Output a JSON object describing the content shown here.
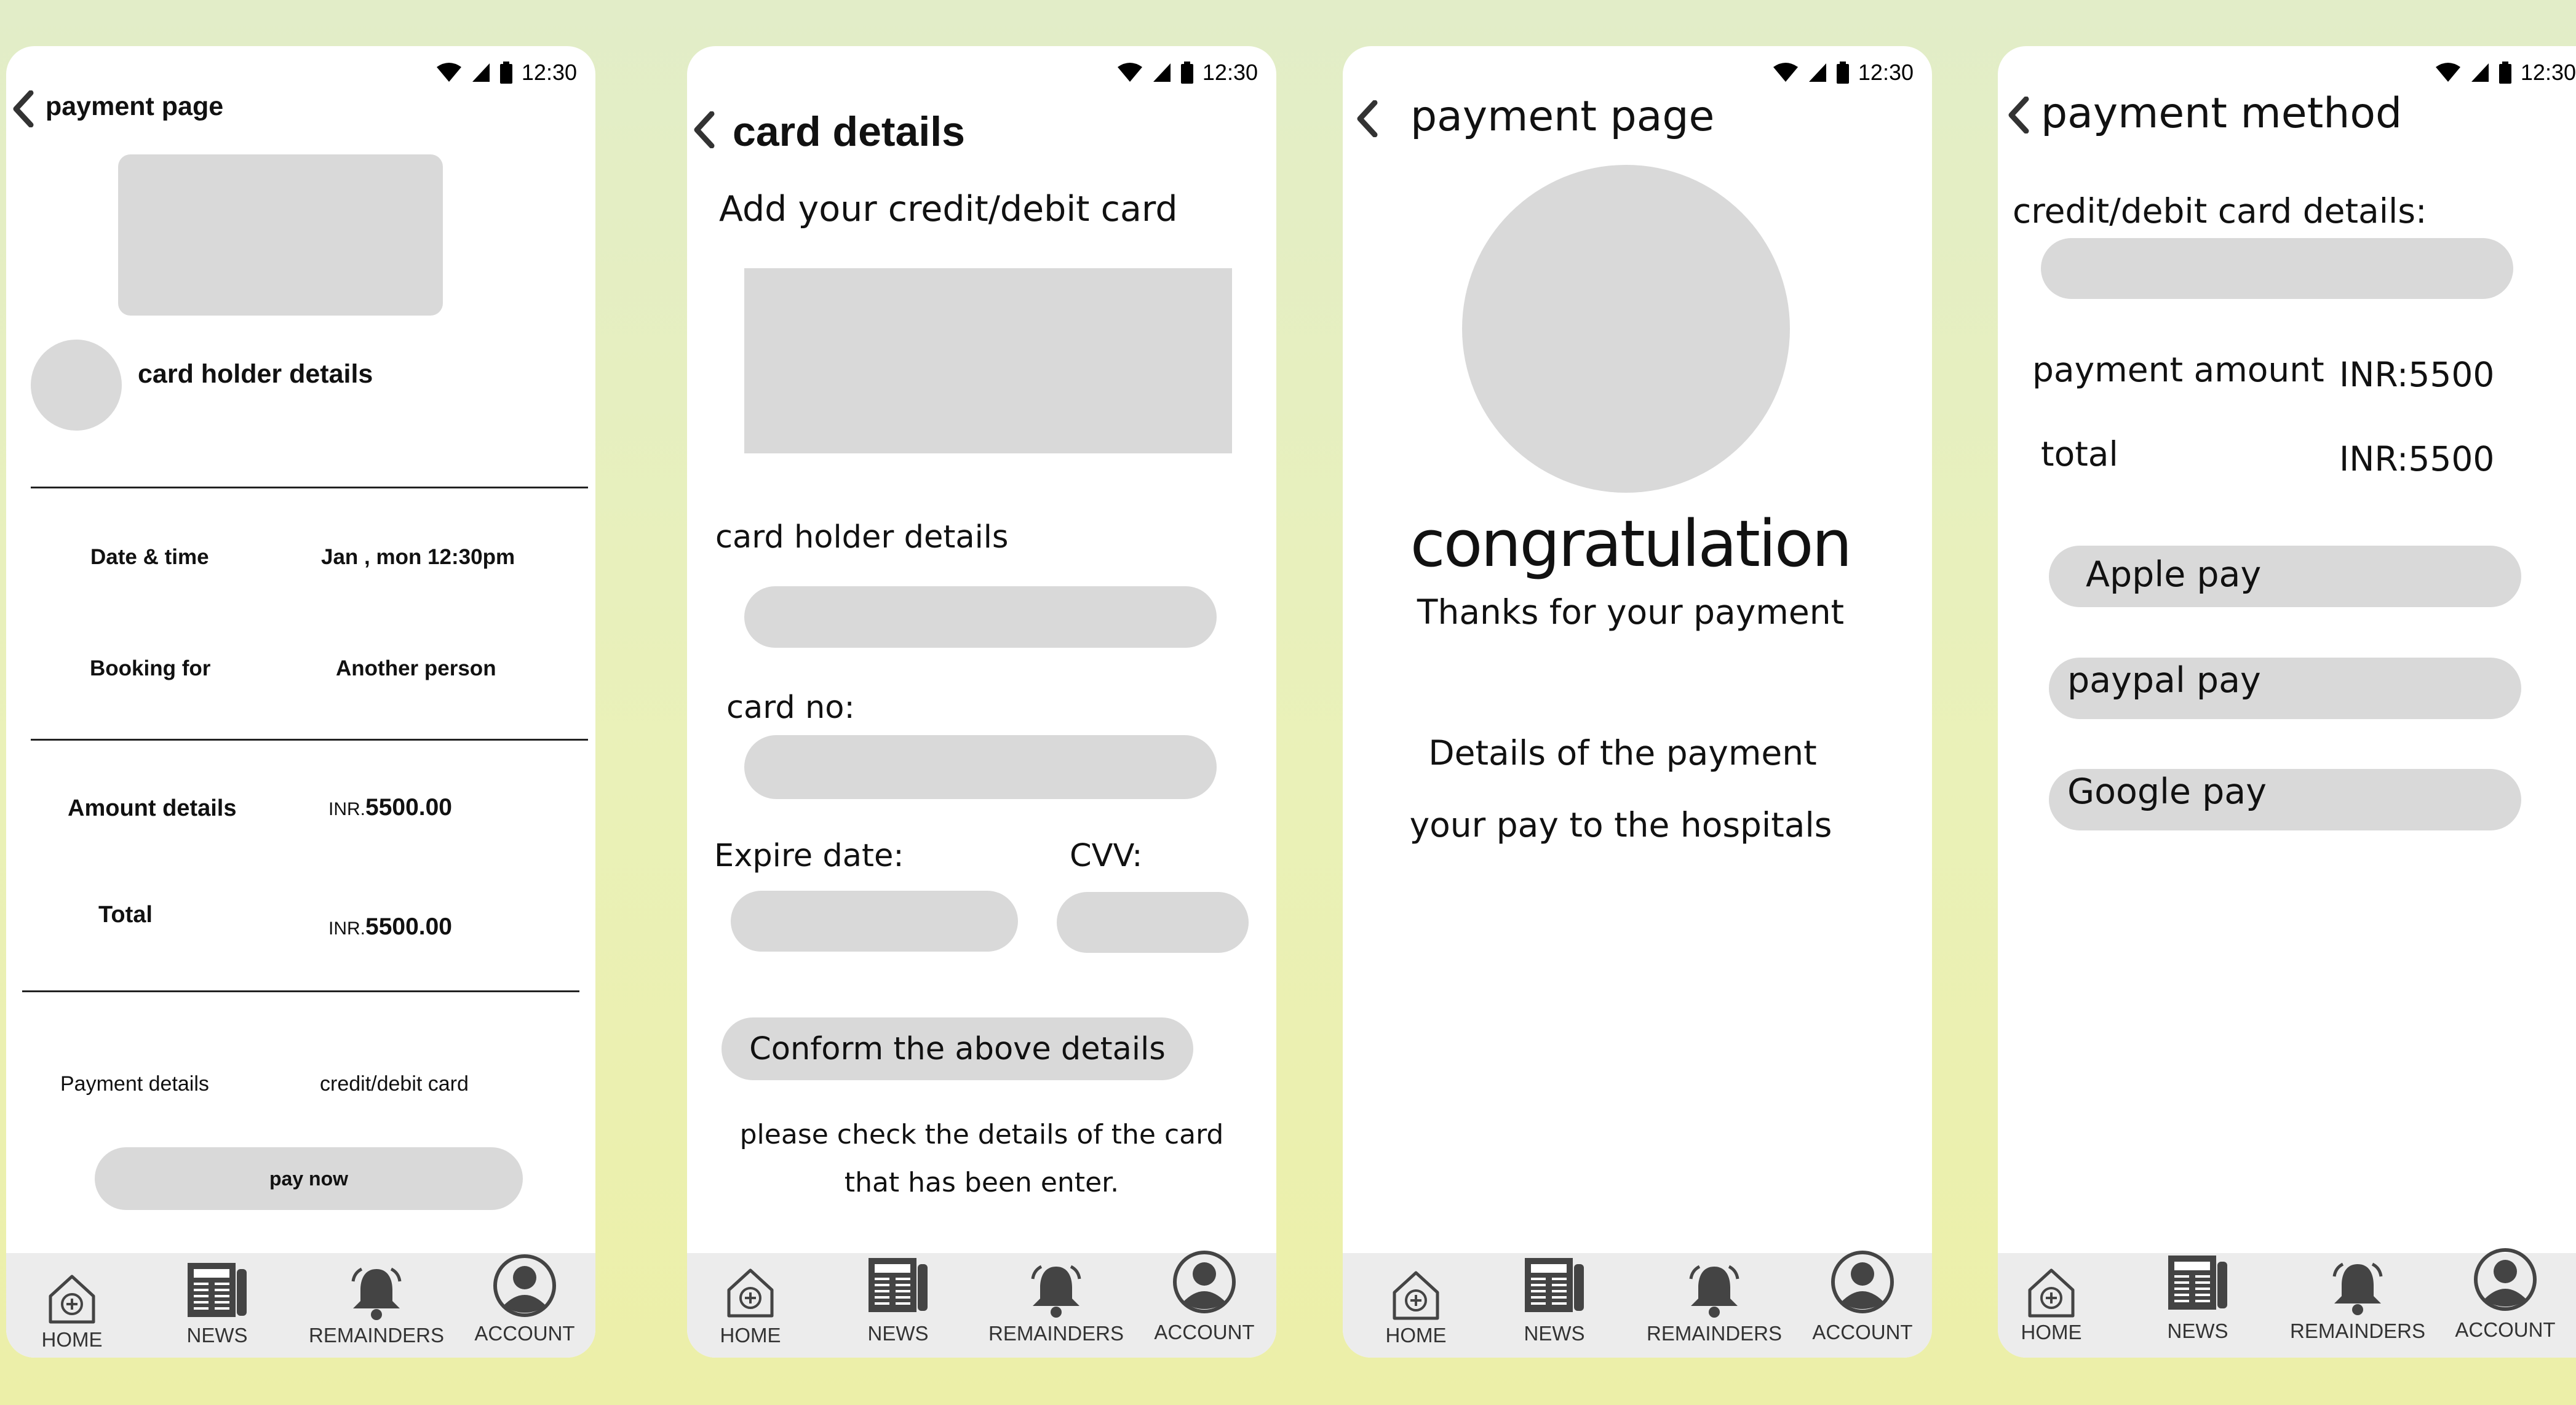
{
  "status_time": "12:30",
  "nav": {
    "home": "HOME",
    "news": "NEWS",
    "reminders": "REMAINDERS",
    "account": "ACCOUNT"
  },
  "screen1": {
    "title": "payment page",
    "card_holder": "card holder details",
    "date_label": "Date & time",
    "date_value": "Jan , mon 12:30pm",
    "booking_label": "Booking for",
    "booking_value": "Another person",
    "amount_label": "Amount details",
    "amount_currency": "INR.",
    "amount_value": "5500.00",
    "total_label": "Total",
    "total_currency": "INR.",
    "total_value": "5500.00",
    "payment_label": "Payment details",
    "payment_value": "credit/debit card",
    "pay_button": "pay now"
  },
  "screen2": {
    "title": "card details",
    "subtitle": "Add your credit/debit card",
    "holder_label": "card holder details",
    "cardno_label": "card no:",
    "expire_label": "Expire date:",
    "cvv_label": "CVV:",
    "confirm_button": "Conform the above details",
    "note_line1": "please check the details of the card",
    "note_line2": "that has been enter."
  },
  "screen3": {
    "title": "payment page",
    "heading": "congratulation",
    "thanks": "Thanks for your payment",
    "details_line1": "Details of the payment",
    "details_line2": "your pay to the hospitals"
  },
  "screen4": {
    "title": "payment method",
    "card_label": "credit/debit card details:",
    "amount_label": "payment amount",
    "amount_value": "INR:5500",
    "total_label": "total",
    "total_value": "INR:5500",
    "apple": "Apple pay",
    "paypal": "paypal pay",
    "google": "Google pay"
  },
  "colors": {
    "placeholder": "#d9d9d9",
    "navbar": "#ececec",
    "screen": "#ffffff"
  }
}
